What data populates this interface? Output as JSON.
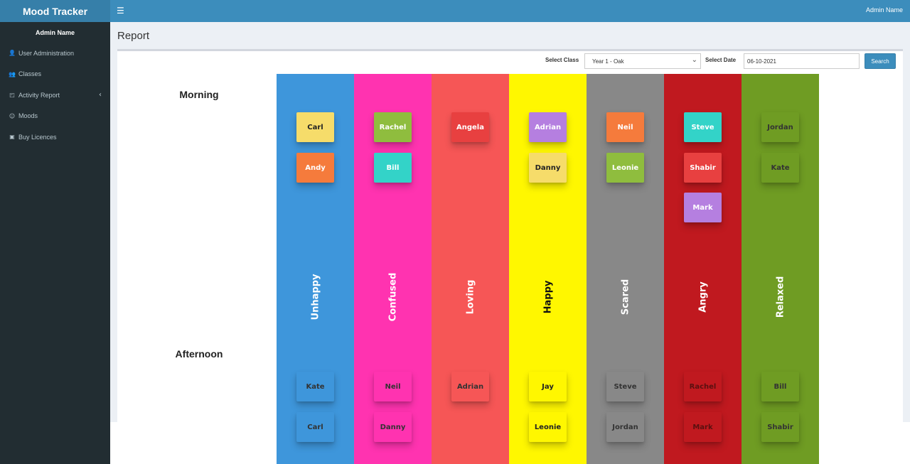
{
  "app": {
    "title": "Mood Tracker",
    "admin_top": "Admin Name"
  },
  "sidebar": {
    "admin_name": "Admin Name",
    "items": [
      {
        "label": "User Administration",
        "icon": "user-icon",
        "glyph": "👤"
      },
      {
        "label": "Classes",
        "icon": "users-icon",
        "glyph": "👥"
      },
      {
        "label": "Activity Report",
        "icon": "report-icon",
        "glyph": "◰",
        "caret": "‹"
      },
      {
        "label": "Moods",
        "icon": "smile-icon",
        "glyph": "☺"
      },
      {
        "label": "Buy Licences",
        "icon": "licence-card-icon",
        "glyph": "▣"
      }
    ]
  },
  "page": {
    "title": "Report"
  },
  "filters": {
    "class_label": "Select Class",
    "class_value": "Year 1 - Oak",
    "date_label": "Select Date",
    "date_value": "06-10-2021",
    "search_label": "Search"
  },
  "sessions": {
    "morning": "Morning",
    "afternoon": "Afternoon"
  },
  "moods": [
    {
      "name": "Unhappy",
      "color": "#3e96db",
      "label_color": "#ffffff",
      "morning": [
        {
          "name": "Carl",
          "bg": "#f6dc6a",
          "fg": "#222222"
        },
        {
          "name": "Andy",
          "bg": "#f57b3c",
          "fg": "#ffffff"
        }
      ],
      "afternoon": [
        {
          "name": "Kate",
          "bg": "#3e96db",
          "fg": "#333333"
        },
        {
          "name": "Carl",
          "bg": "#3e96db",
          "fg": "#333333"
        }
      ]
    },
    {
      "name": "Confused",
      "color": "#ff33b0",
      "label_color": "#ffffff",
      "morning": [
        {
          "name": "Rachel",
          "bg": "#8fbd3e",
          "fg": "#ffffff"
        },
        {
          "name": "Bill",
          "bg": "#33d3c8",
          "fg": "#ffffff"
        }
      ],
      "afternoon": [
        {
          "name": "Neil",
          "bg": "#ff33b0",
          "fg": "#333333"
        },
        {
          "name": "Danny",
          "bg": "#ff33b0",
          "fg": "#333333"
        }
      ]
    },
    {
      "name": "Loving",
      "color": "#f65656",
      "label_color": "#ffffff",
      "morning": [
        {
          "name": "Angela",
          "bg": "#e84040",
          "fg": "#ffffff"
        }
      ],
      "afternoon": [
        {
          "name": "Adrian",
          "bg": "#f65656",
          "fg": "#333333"
        }
      ]
    },
    {
      "name": "Happy",
      "color": "#fff700",
      "label_color": "#111111",
      "morning": [
        {
          "name": "Adrian",
          "bg": "#b57fe0",
          "fg": "#ffffff"
        },
        {
          "name": "Danny",
          "bg": "#f6dc6a",
          "fg": "#222222"
        }
      ],
      "afternoon": [
        {
          "name": "Jay",
          "bg": "#fff700",
          "fg": "#222222"
        },
        {
          "name": "Leonie",
          "bg": "#fff700",
          "fg": "#222222"
        }
      ]
    },
    {
      "name": "Scared",
      "color": "#888888",
      "label_color": "#ffffff",
      "morning": [
        {
          "name": "Neil",
          "bg": "#f57b3c",
          "fg": "#ffffff"
        },
        {
          "name": "Leonie",
          "bg": "#8fbd3e",
          "fg": "#ffffff"
        }
      ],
      "afternoon": [
        {
          "name": "Steve",
          "bg": "#888888",
          "fg": "#333333"
        },
        {
          "name": "Jordan",
          "bg": "#888888",
          "fg": "#333333"
        }
      ]
    },
    {
      "name": "Angry",
      "color": "#c0191f",
      "label_color": "#ffffff",
      "morning": [
        {
          "name": "Steve",
          "bg": "#33d3c8",
          "fg": "#ffffff"
        },
        {
          "name": "Shabir",
          "bg": "#e84040",
          "fg": "#ffffff"
        },
        {
          "name": "Mark",
          "bg": "#b57fe0",
          "fg": "#ffffff"
        }
      ],
      "afternoon": [
        {
          "name": "Rachel",
          "bg": "#c0191f",
          "fg": "#5a1010"
        },
        {
          "name": "Mark",
          "bg": "#c0191f",
          "fg": "#5a1010"
        }
      ]
    },
    {
      "name": "Relaxed",
      "color": "#6f9c23",
      "label_color": "#ffffff",
      "morning": [
        {
          "name": "Jordan",
          "bg": "#6f9c23",
          "fg": "#333333"
        },
        {
          "name": "Kate",
          "bg": "#6f9c23",
          "fg": "#333333"
        }
      ],
      "afternoon": [
        {
          "name": "Bill",
          "bg": "#6f9c23",
          "fg": "#333333"
        },
        {
          "name": "Shabir",
          "bg": "#6f9c23",
          "fg": "#333333"
        }
      ]
    }
  ]
}
